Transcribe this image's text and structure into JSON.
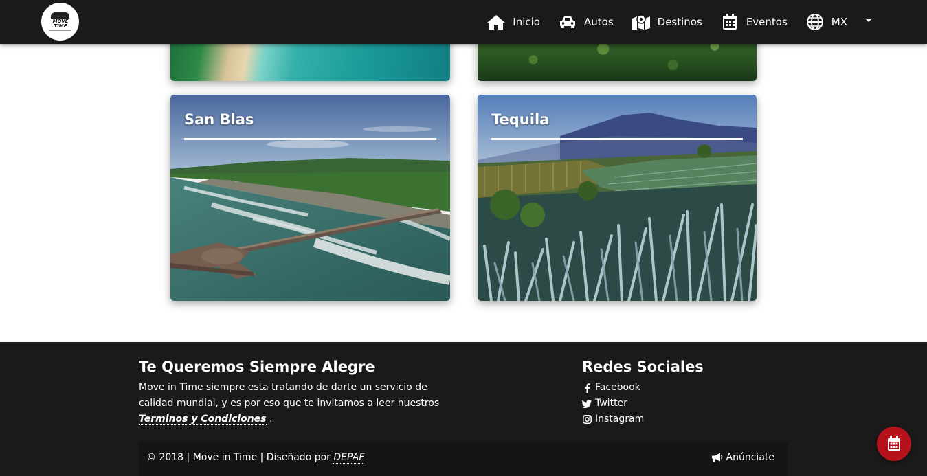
{
  "brand": {
    "logo_line1": "MOVE",
    "logo_line2": "TIME"
  },
  "nav": {
    "items": [
      {
        "label": "Inicio",
        "icon": "home-icon"
      },
      {
        "label": "Autos",
        "icon": "car-icon"
      },
      {
        "label": "Destinos",
        "icon": "map-marker-icon"
      },
      {
        "label": "Eventos",
        "icon": "calendar-icon"
      },
      {
        "label": "MX",
        "icon": "globe-icon"
      }
    ]
  },
  "destinations": [
    {
      "title": "San Blas"
    },
    {
      "title": "Tequila"
    }
  ],
  "footer": {
    "about_title": "Te Queremos Siempre Alegre",
    "about_text": "Move in Time siempre esta tratando de darte un servicio de calidad mundial, y es por eso que te invitamos a leer nuestros",
    "terms_link": "Terminos y Condiciones",
    "about_end": ".",
    "social_title": "Redes Sociales",
    "social": [
      {
        "label": "Facebook",
        "icon": "facebook-icon"
      },
      {
        "label": "Twitter",
        "icon": "twitter-icon"
      },
      {
        "label": "Instagram",
        "icon": "instagram-icon"
      }
    ],
    "copyright": "© 2018 | Move in Time | Diseñado por",
    "designer": "DEPAF",
    "advertise": "Anúnciate"
  },
  "colors": {
    "nav_bg": "#1a1a1a",
    "fab": "#b5121b"
  }
}
